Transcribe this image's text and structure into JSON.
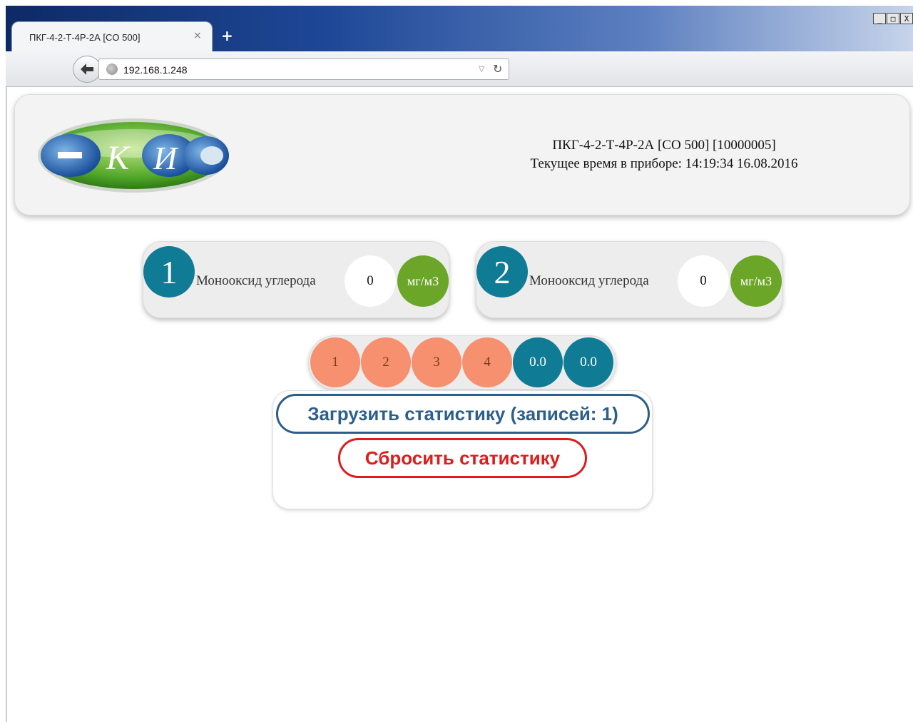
{
  "browser": {
    "tab_title": "ПКГ-4-2-Т-4Р-2А [CO 500]",
    "tab_close": "×",
    "new_tab": "+",
    "url": "192.168.1.248",
    "back_icon": "arrow-left-icon",
    "window_controls": [
      "_",
      "□",
      "X"
    ]
  },
  "header": {
    "logo_text": "ЭКИС",
    "device_name": "ПКГ-4-2-Т-4Р-2А [CO 500] [10000005]",
    "device_time": "Текущее время в приборе: 14:19:34 16.08.2016"
  },
  "sensors": [
    {
      "number": "1",
      "name": "Монооксид углерода",
      "value": "0",
      "unit": "мг/м3"
    },
    {
      "number": "2",
      "name": "Монооксид углерода",
      "value": "0",
      "unit": "мг/м3"
    }
  ],
  "relays": [
    "1",
    "2",
    "3",
    "4",
    "0.0",
    "0.0"
  ],
  "stats": {
    "load_label": "Загрузить статистику (записей: 1)",
    "reset_label": "Сбросить статистику"
  },
  "colors": {
    "teal": "#107b94",
    "green": "#6ca628",
    "salmon": "#f7906f",
    "load_blue": "#2b5f8c",
    "reset_red": "#e01b1b"
  }
}
